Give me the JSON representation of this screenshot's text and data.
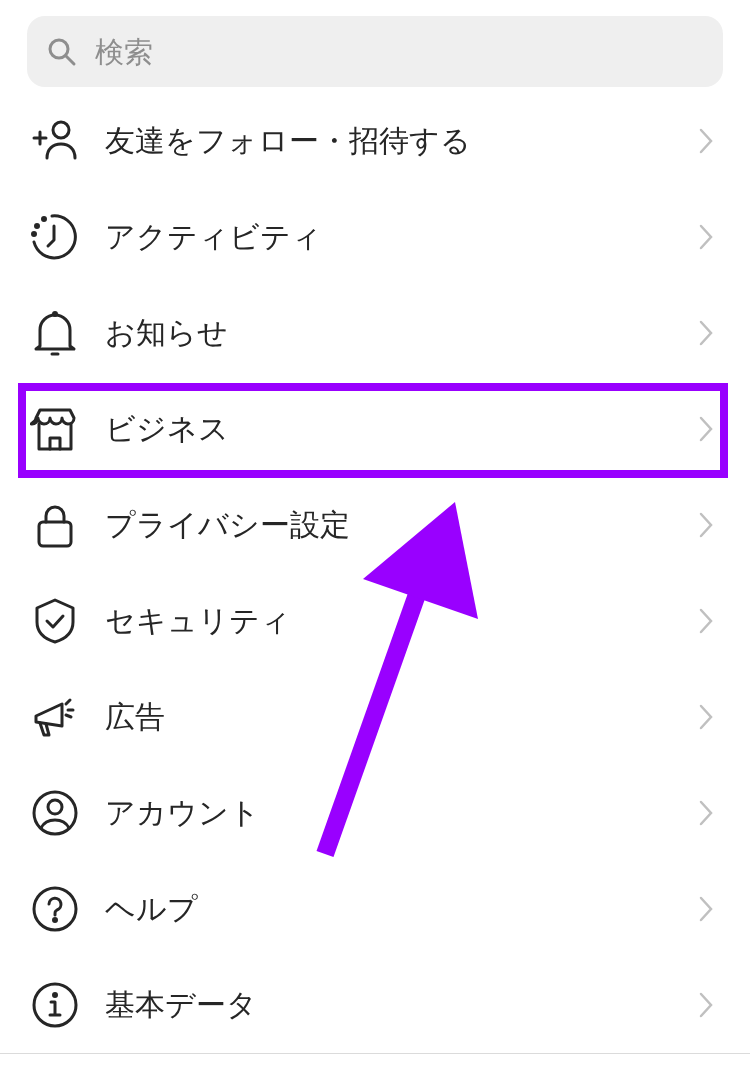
{
  "search": {
    "placeholder": "検索"
  },
  "items": [
    {
      "label": "友達をフォロー・招待する",
      "highlighted": false
    },
    {
      "label": "アクティビティ",
      "highlighted": false
    },
    {
      "label": "お知らせ",
      "highlighted": false
    },
    {
      "label": "ビジネス",
      "highlighted": true
    },
    {
      "label": "プライバシー設定",
      "highlighted": false
    },
    {
      "label": "セキュリティ",
      "highlighted": false
    },
    {
      "label": "広告",
      "highlighted": false
    },
    {
      "label": "アカウント",
      "highlighted": false
    },
    {
      "label": "ヘルプ",
      "highlighted": false
    },
    {
      "label": "基本データ",
      "highlighted": false
    }
  ]
}
